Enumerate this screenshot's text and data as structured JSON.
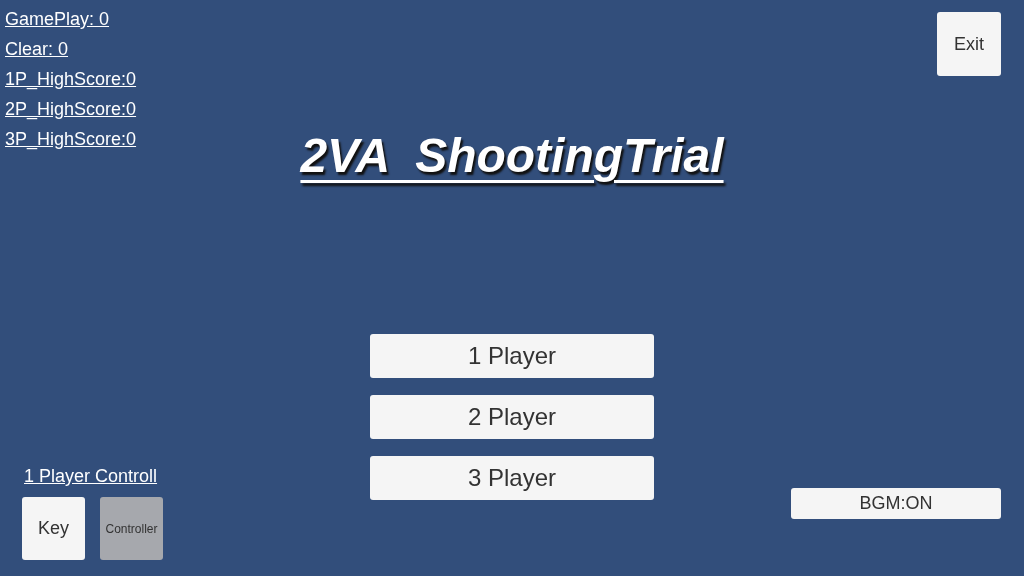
{
  "stats": [
    "GamePlay: 0",
    "Clear: 0",
    "1P_HighScore:0",
    "2P_HighScore:0",
    "3P_HighScore:0"
  ],
  "title": "2VA  ShootingTrial",
  "exit_button": "Exit",
  "player_buttons": [
    "1 Player",
    "2 Player",
    "3 Player"
  ],
  "control": {
    "label": "1 Player Controll",
    "options": [
      {
        "label": "Key",
        "selected": true
      },
      {
        "label": "Controller",
        "selected": false
      }
    ]
  },
  "bgm_button": "BGM:ON"
}
